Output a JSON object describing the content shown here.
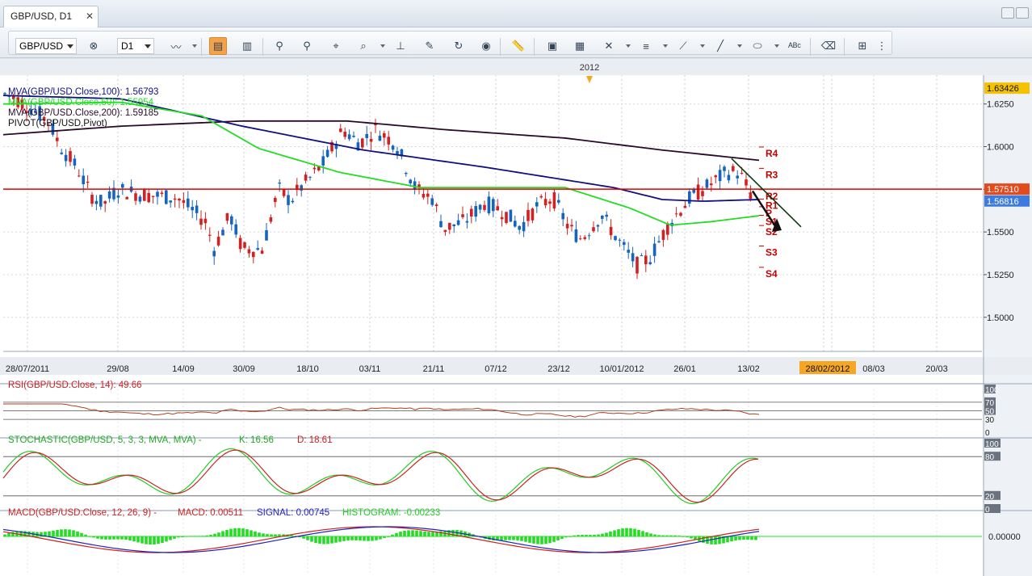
{
  "tab": {
    "title": "GBP/USD, D1",
    "close_glyph": "✕"
  },
  "toolbar": {
    "symbol": "GBP/USD",
    "timeframe": "D1"
  },
  "chart": {
    "year_marker": "2012",
    "price_ticks": [
      "1.6250",
      "1.6000",
      "1.5750",
      "1.5500",
      "1.5250",
      "1.5000"
    ],
    "price_badges": [
      "1.63426",
      "1.57510",
      "1.56816"
    ],
    "date_ticks": [
      "28/07/2011",
      "29/08",
      "14/09",
      "30/09",
      "18/10",
      "03/11",
      "21/11",
      "07/12",
      "23/12",
      "10/01/2012",
      "26/01",
      "13/02",
      "08/03",
      "20/03"
    ],
    "date_highlight": "28/02/2012",
    "legend": [
      {
        "label": "MVA(GBP/USD.Close,100): 1.56793",
        "color": "#101080"
      },
      {
        "label": "MVA(GBP/USD.Close,50): 1.55954",
        "color": "#22dd22"
      },
      {
        "label": "MVA(GBP/USD.Close,200): 1.59185",
        "color": "#2a0a2a"
      },
      {
        "label": "PIVOT(GBP/USD,Pivot)",
        "color": "#111111"
      }
    ],
    "pivot_labels": [
      "R4",
      "R3",
      "R2",
      "R1",
      "P",
      "S1",
      "S2",
      "S3",
      "S4"
    ],
    "colors": {
      "bull": "#1565c0",
      "bear": "#d42020",
      "ma50": "#22dd22",
      "ma100": "#101080",
      "ma200": "#2a0a2a",
      "hline": "#e00000",
      "badge": "#ff6633",
      "badge_blue": "#3377ee",
      "badge_dark": "#f5c200"
    }
  },
  "rsi": {
    "label": "RSI(GBP/USD.Close, 14): 49.66",
    "ticks": [
      "100",
      "70",
      "50",
      "30",
      "0"
    ]
  },
  "stoch": {
    "label_prefix": "STOCHASTIC(GBP/USD, 5, 3, 3, MVA, MVA) -",
    "k_label": "K: 16.56",
    "d_label": "D: 18.61",
    "ticks": [
      "100",
      "80",
      "20",
      "0"
    ]
  },
  "macd": {
    "label_prefix": "MACD(GBP/USD.Close, 12, 26, 9) -",
    "macd_label": "MACD: 0.00511",
    "signal_label": "SIGNAL: 0.00745",
    "hist_label": "HISTOGRAM: -0.00233",
    "tick": "0.00000"
  }
}
